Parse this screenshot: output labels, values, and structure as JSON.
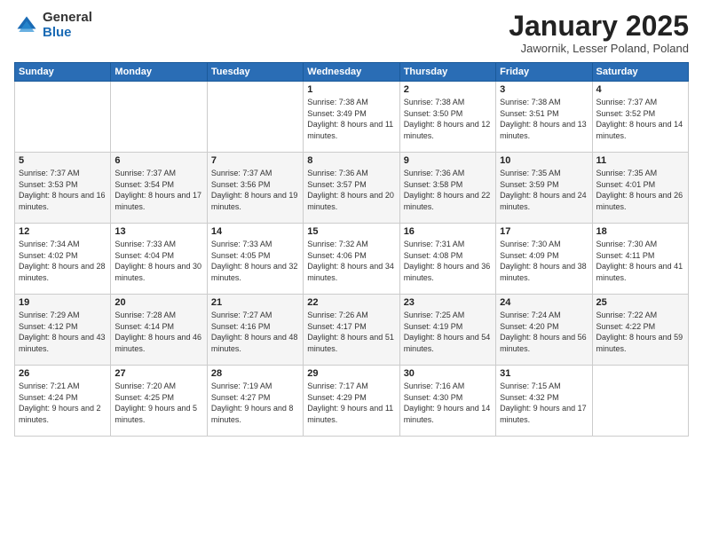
{
  "logo": {
    "general": "General",
    "blue": "Blue"
  },
  "header": {
    "title": "January 2025",
    "subtitle": "Jawornik, Lesser Poland, Poland"
  },
  "weekdays": [
    "Sunday",
    "Monday",
    "Tuesday",
    "Wednesday",
    "Thursday",
    "Friday",
    "Saturday"
  ],
  "weeks": [
    [
      {
        "day": "",
        "sunrise": "",
        "sunset": "",
        "daylight": ""
      },
      {
        "day": "",
        "sunrise": "",
        "sunset": "",
        "daylight": ""
      },
      {
        "day": "",
        "sunrise": "",
        "sunset": "",
        "daylight": ""
      },
      {
        "day": "1",
        "sunrise": "Sunrise: 7:38 AM",
        "sunset": "Sunset: 3:49 PM",
        "daylight": "Daylight: 8 hours and 11 minutes."
      },
      {
        "day": "2",
        "sunrise": "Sunrise: 7:38 AM",
        "sunset": "Sunset: 3:50 PM",
        "daylight": "Daylight: 8 hours and 12 minutes."
      },
      {
        "day": "3",
        "sunrise": "Sunrise: 7:38 AM",
        "sunset": "Sunset: 3:51 PM",
        "daylight": "Daylight: 8 hours and 13 minutes."
      },
      {
        "day": "4",
        "sunrise": "Sunrise: 7:37 AM",
        "sunset": "Sunset: 3:52 PM",
        "daylight": "Daylight: 8 hours and 14 minutes."
      }
    ],
    [
      {
        "day": "5",
        "sunrise": "Sunrise: 7:37 AM",
        "sunset": "Sunset: 3:53 PM",
        "daylight": "Daylight: 8 hours and 16 minutes."
      },
      {
        "day": "6",
        "sunrise": "Sunrise: 7:37 AM",
        "sunset": "Sunset: 3:54 PM",
        "daylight": "Daylight: 8 hours and 17 minutes."
      },
      {
        "day": "7",
        "sunrise": "Sunrise: 7:37 AM",
        "sunset": "Sunset: 3:56 PM",
        "daylight": "Daylight: 8 hours and 19 minutes."
      },
      {
        "day": "8",
        "sunrise": "Sunrise: 7:36 AM",
        "sunset": "Sunset: 3:57 PM",
        "daylight": "Daylight: 8 hours and 20 minutes."
      },
      {
        "day": "9",
        "sunrise": "Sunrise: 7:36 AM",
        "sunset": "Sunset: 3:58 PM",
        "daylight": "Daylight: 8 hours and 22 minutes."
      },
      {
        "day": "10",
        "sunrise": "Sunrise: 7:35 AM",
        "sunset": "Sunset: 3:59 PM",
        "daylight": "Daylight: 8 hours and 24 minutes."
      },
      {
        "day": "11",
        "sunrise": "Sunrise: 7:35 AM",
        "sunset": "Sunset: 4:01 PM",
        "daylight": "Daylight: 8 hours and 26 minutes."
      }
    ],
    [
      {
        "day": "12",
        "sunrise": "Sunrise: 7:34 AM",
        "sunset": "Sunset: 4:02 PM",
        "daylight": "Daylight: 8 hours and 28 minutes."
      },
      {
        "day": "13",
        "sunrise": "Sunrise: 7:33 AM",
        "sunset": "Sunset: 4:04 PM",
        "daylight": "Daylight: 8 hours and 30 minutes."
      },
      {
        "day": "14",
        "sunrise": "Sunrise: 7:33 AM",
        "sunset": "Sunset: 4:05 PM",
        "daylight": "Daylight: 8 hours and 32 minutes."
      },
      {
        "day": "15",
        "sunrise": "Sunrise: 7:32 AM",
        "sunset": "Sunset: 4:06 PM",
        "daylight": "Daylight: 8 hours and 34 minutes."
      },
      {
        "day": "16",
        "sunrise": "Sunrise: 7:31 AM",
        "sunset": "Sunset: 4:08 PM",
        "daylight": "Daylight: 8 hours and 36 minutes."
      },
      {
        "day": "17",
        "sunrise": "Sunrise: 7:30 AM",
        "sunset": "Sunset: 4:09 PM",
        "daylight": "Daylight: 8 hours and 38 minutes."
      },
      {
        "day": "18",
        "sunrise": "Sunrise: 7:30 AM",
        "sunset": "Sunset: 4:11 PM",
        "daylight": "Daylight: 8 hours and 41 minutes."
      }
    ],
    [
      {
        "day": "19",
        "sunrise": "Sunrise: 7:29 AM",
        "sunset": "Sunset: 4:12 PM",
        "daylight": "Daylight: 8 hours and 43 minutes."
      },
      {
        "day": "20",
        "sunrise": "Sunrise: 7:28 AM",
        "sunset": "Sunset: 4:14 PM",
        "daylight": "Daylight: 8 hours and 46 minutes."
      },
      {
        "day": "21",
        "sunrise": "Sunrise: 7:27 AM",
        "sunset": "Sunset: 4:16 PM",
        "daylight": "Daylight: 8 hours and 48 minutes."
      },
      {
        "day": "22",
        "sunrise": "Sunrise: 7:26 AM",
        "sunset": "Sunset: 4:17 PM",
        "daylight": "Daylight: 8 hours and 51 minutes."
      },
      {
        "day": "23",
        "sunrise": "Sunrise: 7:25 AM",
        "sunset": "Sunset: 4:19 PM",
        "daylight": "Daylight: 8 hours and 54 minutes."
      },
      {
        "day": "24",
        "sunrise": "Sunrise: 7:24 AM",
        "sunset": "Sunset: 4:20 PM",
        "daylight": "Daylight: 8 hours and 56 minutes."
      },
      {
        "day": "25",
        "sunrise": "Sunrise: 7:22 AM",
        "sunset": "Sunset: 4:22 PM",
        "daylight": "Daylight: 8 hours and 59 minutes."
      }
    ],
    [
      {
        "day": "26",
        "sunrise": "Sunrise: 7:21 AM",
        "sunset": "Sunset: 4:24 PM",
        "daylight": "Daylight: 9 hours and 2 minutes."
      },
      {
        "day": "27",
        "sunrise": "Sunrise: 7:20 AM",
        "sunset": "Sunset: 4:25 PM",
        "daylight": "Daylight: 9 hours and 5 minutes."
      },
      {
        "day": "28",
        "sunrise": "Sunrise: 7:19 AM",
        "sunset": "Sunset: 4:27 PM",
        "daylight": "Daylight: 9 hours and 8 minutes."
      },
      {
        "day": "29",
        "sunrise": "Sunrise: 7:17 AM",
        "sunset": "Sunset: 4:29 PM",
        "daylight": "Daylight: 9 hours and 11 minutes."
      },
      {
        "day": "30",
        "sunrise": "Sunrise: 7:16 AM",
        "sunset": "Sunset: 4:30 PM",
        "daylight": "Daylight: 9 hours and 14 minutes."
      },
      {
        "day": "31",
        "sunrise": "Sunrise: 7:15 AM",
        "sunset": "Sunset: 4:32 PM",
        "daylight": "Daylight: 9 hours and 17 minutes."
      },
      {
        "day": "",
        "sunrise": "",
        "sunset": "",
        "daylight": ""
      }
    ]
  ]
}
